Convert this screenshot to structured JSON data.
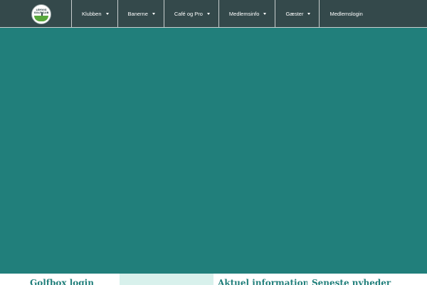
{
  "header": {
    "logo_text": "LEMVIG GOLFKLUB",
    "nav": [
      {
        "label": "Klubben",
        "has_dropdown": true
      },
      {
        "label": "Banerne",
        "has_dropdown": true
      },
      {
        "label": "Café og Pro",
        "has_dropdown": true
      },
      {
        "label": "Medlemsinfo",
        "has_dropdown": true
      },
      {
        "label": "Gæster",
        "has_dropdown": true
      },
      {
        "label": "Medlemslogin",
        "has_dropdown": false
      }
    ]
  },
  "footer": {
    "columns": [
      {
        "title": "Golfbox login"
      },
      {
        "title": ""
      },
      {
        "title": "Aktuel information"
      },
      {
        "title": "Seneste nyheder"
      }
    ]
  },
  "colors": {
    "topbar": "#34494b",
    "hero": "#217f7b",
    "accent_mint": "#d8f1ec",
    "heading": "#217f7b"
  }
}
